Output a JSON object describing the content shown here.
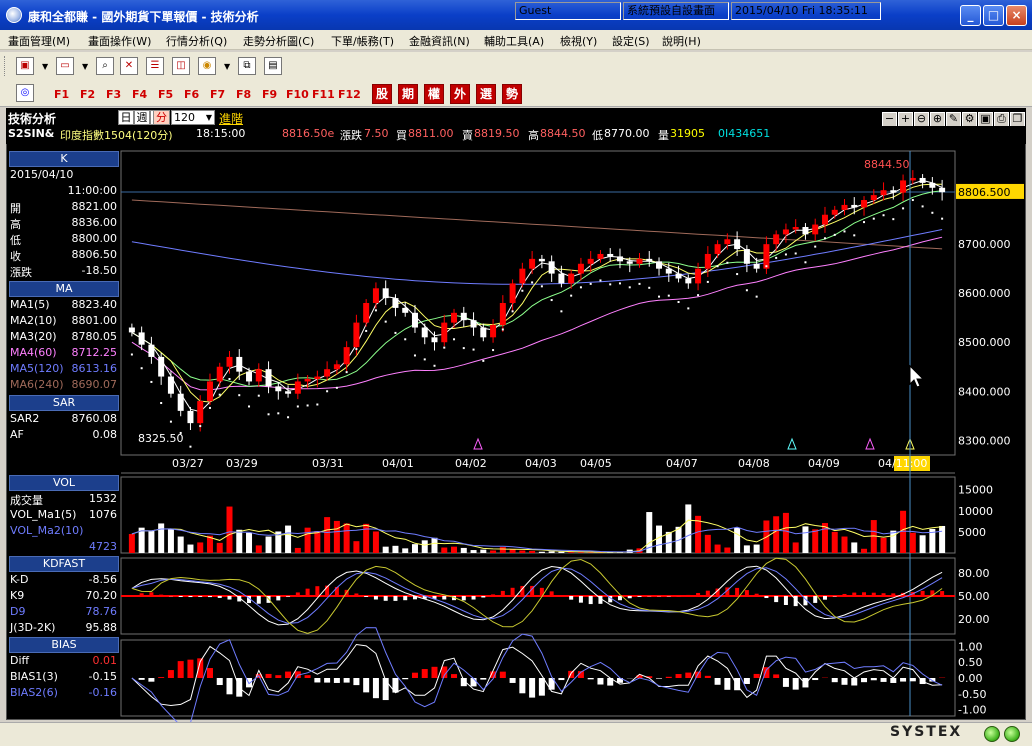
{
  "window": {
    "title": "康和全都賺 - 國外期貨下單報價 - 技術分析",
    "minimize": "_",
    "maximize": "□",
    "close": "×"
  },
  "menu": [
    "畫面管理(M)",
    "畫面操作(W)",
    "行情分析(Q)",
    "走勢分析圖(C)",
    "下單/帳務(T)",
    "金融資訊(N)",
    "輔助工具(A)",
    "檢視(Y)",
    "設定(S)",
    "說明(H)"
  ],
  "toolbar2": {
    "fkeys": [
      "F1",
      "F2",
      "F3",
      "F4",
      "F5",
      "F6",
      "F7",
      "F8",
      "F9",
      "F10",
      "F11",
      "F12"
    ],
    "quick": [
      "股",
      "期",
      "權",
      "外",
      "選",
      "勢"
    ]
  },
  "chart_header": {
    "label": "技術分析",
    "periods": [
      "日",
      "週",
      "月",
      "分"
    ],
    "active_period": "分",
    "count": "120",
    "advanced": "進階"
  },
  "quote": {
    "symbol": "S2SIN&",
    "name": "印度指數1504(120分)",
    "time": "18:15:00",
    "last": "8816.50e",
    "change_label": "漲跌",
    "change": "7.50",
    "bid_label": "買",
    "bid": "8811.00",
    "ask_label": "賣",
    "ask": "8819.50",
    "high_label": "高",
    "high": "8844.50",
    "low_label": "低",
    "low": "8770.00",
    "vol_label": "量",
    "vol": "31905",
    "oi": "0I434651"
  },
  "panels": {
    "k": {
      "title": "K",
      "date": "2015/04/10",
      "time": "11:00:00",
      "rows": [
        {
          "label": "開",
          "value": "8821.00"
        },
        {
          "label": "高",
          "value": "8836.00"
        },
        {
          "label": "低",
          "value": "8800.00"
        },
        {
          "label": "收",
          "value": "8806.50"
        },
        {
          "label": "漲跌",
          "value": "-18.50"
        }
      ]
    },
    "ma": {
      "title": "MA",
      "rows": [
        {
          "label": "MA1(5)",
          "value": "8823.40",
          "color": "#ffffff"
        },
        {
          "label": "MA2(10)",
          "value": "8801.00",
          "color": "#ffffff"
        },
        {
          "label": "MA3(20)",
          "value": "8780.05",
          "color": "#ffffff"
        },
        {
          "label": "MA4(60)",
          "value": "8712.25",
          "color": "#ff80ff"
        },
        {
          "label": "MA5(120)",
          "value": "8613.16",
          "color": "#6f7cff"
        },
        {
          "label": "MA6(240)",
          "value": "8690.07",
          "color": "#a06a5a"
        }
      ]
    },
    "sar": {
      "title": "SAR",
      "rows": [
        {
          "label": "SAR2",
          "value": "8760.08"
        },
        {
          "label": "AF",
          "value": "0.08"
        }
      ]
    },
    "vol": {
      "title": "VOL",
      "rows": [
        {
          "label": "成交量",
          "value": "1532"
        },
        {
          "label": "VOL_Ma1(5)",
          "value": "1076"
        },
        {
          "label": "VOL_Ma2(10)",
          "value": ""
        },
        {
          "label": "",
          "value": "4723"
        }
      ]
    },
    "kd": {
      "title": "KDFAST",
      "rows": [
        {
          "label": "K-D",
          "value": "-8.56"
        },
        {
          "label": "K9",
          "value": "70.20"
        },
        {
          "label": "D9",
          "value": "78.76"
        },
        {
          "label": "J(3D-2K)",
          "value": "95.88"
        }
      ]
    },
    "bias": {
      "title": "BIAS",
      "rows": [
        {
          "label": "Diff",
          "value": "0.01"
        },
        {
          "label": "BIAS1(3)",
          "value": "-0.15"
        },
        {
          "label": "BIAS2(6)",
          "value": "-0.16"
        }
      ]
    }
  },
  "chart_data": {
    "type": "candlestick",
    "price_axis": [
      "8700.000",
      "8600.000",
      "8500.000",
      "8400.000",
      "8300.000"
    ],
    "price_ylim": [
      8270,
      8890
    ],
    "last_price_tag": "8806.500",
    "high_label": "8844.50",
    "low_label": "8325.50",
    "date_labels": [
      "03/27",
      "03/29",
      "03/31",
      "04/01",
      "04/02",
      "04/03",
      "04/05",
      "04/07",
      "04/08",
      "04/09",
      "04/11:00"
    ],
    "closes": [
      8520,
      8495,
      8470,
      8430,
      8395,
      8360,
      8335,
      8380,
      8420,
      8450,
      8470,
      8440,
      8420,
      8445,
      8410,
      8400,
      8395,
      8420,
      8425,
      8430,
      8445,
      8455,
      8490,
      8540,
      8580,
      8610,
      8590,
      8570,
      8560,
      8530,
      8510,
      8500,
      8540,
      8560,
      8545,
      8530,
      8510,
      8535,
      8580,
      8620,
      8650,
      8670,
      8665,
      8640,
      8620,
      8640,
      8660,
      8670,
      8680,
      8675,
      8665,
      8660,
      8670,
      8665,
      8650,
      8640,
      8630,
      8620,
      8650,
      8680,
      8700,
      8710,
      8690,
      8660,
      8650,
      8700,
      8720,
      8730,
      8735,
      8720,
      8740,
      8760,
      8770,
      8780,
      8775,
      8790,
      8800,
      8810,
      8805,
      8830,
      8835,
      8825,
      8815,
      8806
    ],
    "volume_axis": [
      "15000",
      "10000",
      "5000"
    ],
    "volumes": [
      4500,
      6000,
      5200,
      7000,
      5800,
      3900,
      2000,
      2500,
      4100,
      2400,
      11000,
      5500,
      4800,
      1800,
      3900,
      5100,
      6500,
      1200,
      6000,
      5200,
      8500,
      7600,
      7000,
      2800,
      6900,
      5100,
      1500,
      1700,
      1100,
      2100,
      3000,
      3600,
      1300,
      1500,
      1200,
      700,
      800,
      600,
      1400,
      900,
      600,
      500,
      300,
      400,
      300,
      200,
      200,
      100,
      100,
      200,
      300,
      800,
      1100,
      9700,
      6500,
      5000,
      6200,
      11500,
      8800,
      4300,
      2000,
      1300,
      6000,
      1800,
      2000,
      7700,
      8700,
      9500,
      2500,
      6300,
      5600,
      7100,
      5000,
      3900,
      2500,
      1000,
      7800,
      3600,
      5300,
      10000,
      4800,
      4200,
      5700,
      6400,
      4000,
      2700,
      1500
    ],
    "kd_axis": [
      "80.00",
      "50.00",
      "20.00"
    ],
    "bias_axis": [
      "1.00",
      "0.50",
      "0.00",
      "-0.50",
      "-1.00"
    ],
    "ma_colors": [
      "#ffffff",
      "#ffff66",
      "#8cff8c",
      "#ff80ff",
      "#6f7cff",
      "#a06a5a"
    ],
    "up_color": "#ff0000",
    "down_color": "#ffffff"
  },
  "statusbar": {
    "user": "Guest",
    "layout": "系統預設自設畫面",
    "datetime": "2015/04/10 Fri 18:35:11",
    "brand": "SYSTEX"
  }
}
